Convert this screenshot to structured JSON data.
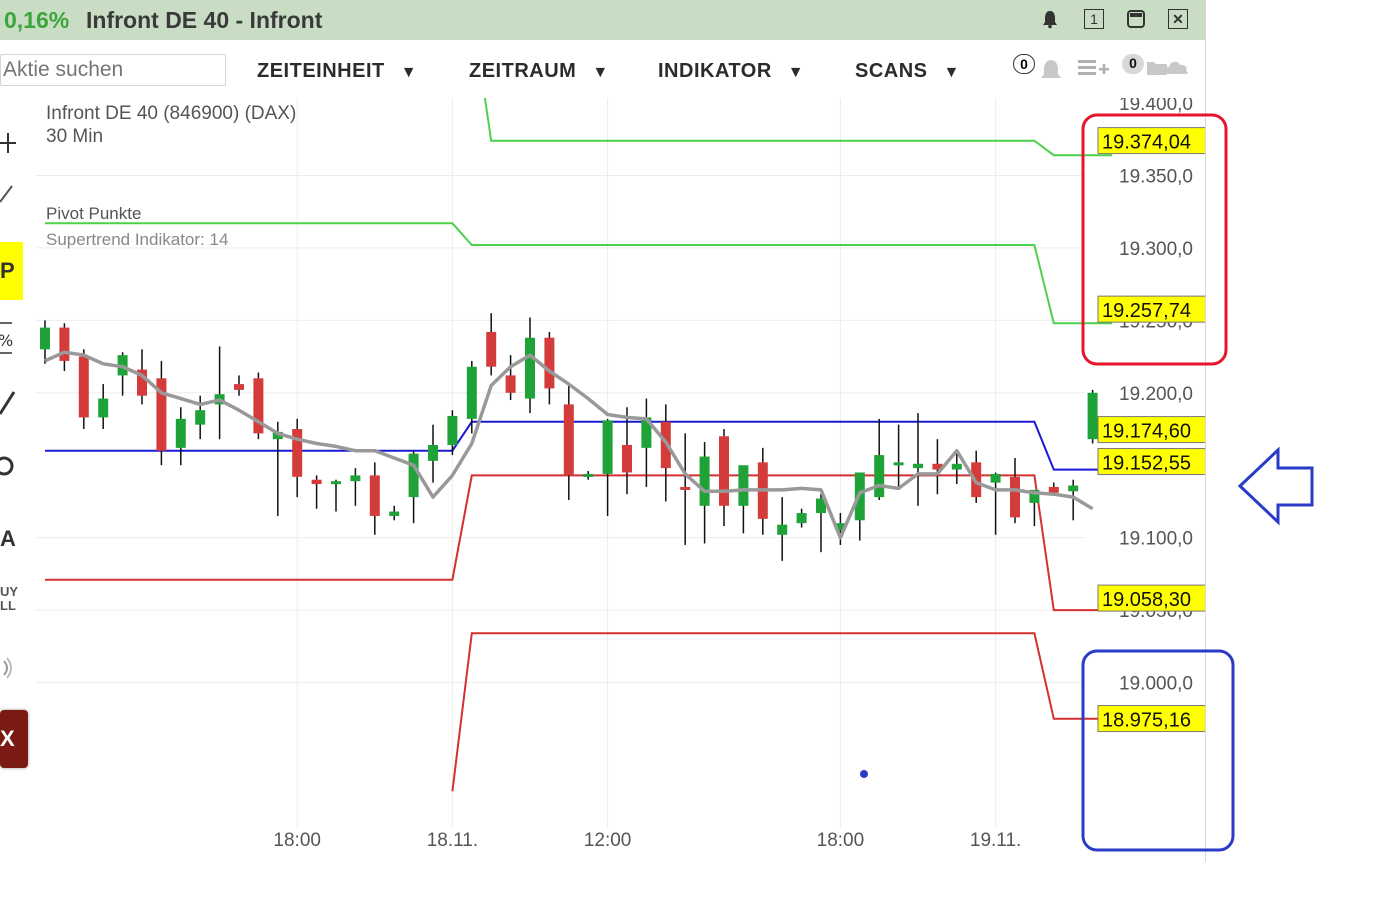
{
  "window": {
    "change_pct": "0,16%",
    "title": "Infront DE 40 - Infront"
  },
  "toolbar": {
    "search_placeholder": "Aktie suchen",
    "menus": [
      {
        "label": "ZEITEINHEIT"
      },
      {
        "label": "ZEITRAUM"
      },
      {
        "label": "INDIKATOR"
      },
      {
        "label": "SCANS"
      }
    ],
    "alerts_count": "0",
    "notes_count": "0"
  },
  "side_tools": [
    "crosshair-icon",
    "line-tool-icon",
    "pivot-icon",
    "percent-icon",
    "pen-icon",
    "circle-icon",
    "text-tool-icon",
    "buy-sell-icon",
    "sound-icon",
    "close-panel-icon"
  ],
  "side_labels": {
    "pivot": "P",
    "text": "A",
    "buysell": "UY\nLL",
    "close": "X"
  },
  "colors": {
    "titlebar": "#c8ddc4",
    "up_candle": "#1fa339",
    "down_candle": "#d43c3c",
    "supertrend": "#999999",
    "pivot_center": "#1a1ad6",
    "resistance": "#4cd14c",
    "support": "#d43030",
    "price_tag": "#ffff00",
    "red_box": "#e8142a",
    "blue_box": "#2a3bc8",
    "arrow": "#2a3bc8"
  },
  "chart_data": {
    "type": "candlestick",
    "title": "Infront DE 40 (846900) (DAX)",
    "subtitle": "30 Min",
    "legend": [
      "Pivot Punkte",
      "Supertrend Indikator: 14"
    ],
    "ylim": [
      18930,
      19400
    ],
    "yticks": [
      {
        "value": 19400,
        "label": "19.400,0"
      },
      {
        "value": 19350,
        "label": "19.350,0"
      },
      {
        "value": 19300,
        "label": "19.300,0"
      },
      {
        "value": 19250,
        "label": "19.250,0"
      },
      {
        "value": 19200,
        "label": "19.200,0"
      },
      {
        "value": 19100,
        "label": "19.100,0"
      },
      {
        "value": 19050,
        "label": "19.050,0"
      },
      {
        "value": 19000,
        "label": "19.000,0"
      }
    ],
    "xticks": [
      {
        "index": 13,
        "label": "18:00"
      },
      {
        "index": 21,
        "label": "18.11."
      },
      {
        "index": 29,
        "label": "12:00"
      },
      {
        "index": 41,
        "label": "18:00"
      },
      {
        "index": 49,
        "label": "19.11."
      }
    ],
    "candles": [
      {
        "o": 19230,
        "h": 19250,
        "l": 19220,
        "c": 19245
      },
      {
        "o": 19245,
        "h": 19248,
        "l": 19215,
        "c": 19222
      },
      {
        "o": 19225,
        "h": 19230,
        "l": 19175,
        "c": 19183
      },
      {
        "o": 19183,
        "h": 19206,
        "l": 19175,
        "c": 19196
      },
      {
        "o": 19212,
        "h": 19228,
        "l": 19198,
        "c": 19226
      },
      {
        "o": 19216,
        "h": 19230,
        "l": 19192,
        "c": 19198
      },
      {
        "o": 19210,
        "h": 19222,
        "l": 19150,
        "c": 19160
      },
      {
        "o": 19162,
        "h": 19190,
        "l": 19150,
        "c": 19182
      },
      {
        "o": 19178,
        "h": 19198,
        "l": 19168,
        "c": 19188
      },
      {
        "o": 19192,
        "h": 19232,
        "l": 19168,
        "c": 19199
      },
      {
        "o": 19206,
        "h": 19212,
        "l": 19198,
        "c": 19202
      },
      {
        "o": 19210,
        "h": 19214,
        "l": 19168,
        "c": 19172
      },
      {
        "o": 19168,
        "h": 19180,
        "l": 19115,
        "c": 19173
      },
      {
        "o": 19175,
        "h": 19182,
        "l": 19128,
        "c": 19142
      },
      {
        "o": 19140,
        "h": 19143,
        "l": 19120,
        "c": 19137
      },
      {
        "o": 19137,
        "h": 19140,
        "l": 19118,
        "c": 19139
      },
      {
        "o": 19139,
        "h": 19148,
        "l": 19122,
        "c": 19143
      },
      {
        "o": 19143,
        "h": 19152,
        "l": 19102,
        "c": 19115
      },
      {
        "o": 19115,
        "h": 19122,
        "l": 19112,
        "c": 19118
      },
      {
        "o": 19128,
        "h": 19160,
        "l": 19110,
        "c": 19158
      },
      {
        "o": 19153,
        "h": 19178,
        "l": 19138,
        "c": 19164
      },
      {
        "o": 19164,
        "h": 19188,
        "l": 19157,
        "c": 19184
      },
      {
        "o": 19182,
        "h": 19222,
        "l": 19172,
        "c": 19218
      },
      {
        "o": 19242,
        "h": 19255,
        "l": 19212,
        "c": 19218
      },
      {
        "o": 19212,
        "h": 19226,
        "l": 19195,
        "c": 19200
      },
      {
        "o": 19196,
        "h": 19252,
        "l": 19186,
        "c": 19238
      },
      {
        "o": 19238,
        "h": 19242,
        "l": 19192,
        "c": 19203
      },
      {
        "o": 19192,
        "h": 19205,
        "l": 19126,
        "c": 19143
      },
      {
        "o": 19143,
        "h": 19146,
        "l": 19140,
        "c": 19144
      },
      {
        "o": 19144,
        "h": 19182,
        "l": 19115,
        "c": 19181
      },
      {
        "o": 19164,
        "h": 19190,
        "l": 19130,
        "c": 19145
      },
      {
        "o": 19162,
        "h": 19196,
        "l": 19135,
        "c": 19183
      },
      {
        "o": 19180,
        "h": 19192,
        "l": 19125,
        "c": 19148
      },
      {
        "o": 19135,
        "h": 19172,
        "l": 19095,
        "c": 19133
      },
      {
        "o": 19122,
        "h": 19166,
        "l": 19096,
        "c": 19156
      },
      {
        "o": 19170,
        "h": 19175,
        "l": 19108,
        "c": 19122
      },
      {
        "o": 19122,
        "h": 19130,
        "l": 19103,
        "c": 19150
      },
      {
        "o": 19152,
        "h": 19162,
        "l": 19102,
        "c": 19113
      },
      {
        "o": 19102,
        "h": 19128,
        "l": 19084,
        "c": 19109
      },
      {
        "o": 19110,
        "h": 19120,
        "l": 19107,
        "c": 19117
      },
      {
        "o": 19117,
        "h": 19130,
        "l": 19090,
        "c": 19127
      },
      {
        "o": 19105,
        "h": 19117,
        "l": 19095,
        "c": 19110
      },
      {
        "o": 19112,
        "h": 19125,
        "l": 19098,
        "c": 19145
      },
      {
        "o": 19128,
        "h": 19182,
        "l": 19126,
        "c": 19157
      },
      {
        "o": 19152,
        "h": 19178,
        "l": 19134,
        "c": 19152
      },
      {
        "o": 19148,
        "h": 19186,
        "l": 19122,
        "c": 19151
      },
      {
        "o": 19151,
        "h": 19168,
        "l": 19130,
        "c": 19147
      },
      {
        "o": 19147,
        "h": 19158,
        "l": 19137,
        "c": 19151
      },
      {
        "o": 19152,
        "h": 19160,
        "l": 19124,
        "c": 19128
      },
      {
        "o": 19138,
        "h": 19145,
        "l": 19102,
        "c": 19144
      },
      {
        "o": 19142,
        "h": 19155,
        "l": 19110,
        "c": 19114
      },
      {
        "o": 19124,
        "h": 19132,
        "l": 19108,
        "c": 19133
      },
      {
        "o": 19135,
        "h": 19138,
        "l": 19130,
        "c": 19131
      },
      {
        "o": 19132,
        "h": 19140,
        "l": 19112,
        "c": 19136
      },
      {
        "o": 19168,
        "h": 19202,
        "l": 19165,
        "c": 19200
      }
    ],
    "supertrend": [
      19222,
      19228,
      19226,
      19220,
      19218,
      19212,
      19200,
      19196,
      19192,
      19195,
      19188,
      19180,
      19172,
      19168,
      19165,
      19163,
      19160,
      19160,
      19155,
      19150,
      19128,
      19143,
      19165,
      19205,
      19218,
      19226,
      19215,
      19206,
      19196,
      19185,
      19183,
      19182,
      19166,
      19144,
      19132,
      19132,
      19133,
      19133,
      19133,
      19134,
      19133,
      19100,
      19131,
      19136,
      19134,
      19144,
      19144,
      19160,
      19138,
      19133,
      19133,
      19131,
      19130,
      19128,
      19120
    ],
    "lines": [
      {
        "name": "R2",
        "points": [
          [
            0,
            19465
          ],
          [
            22,
            19465
          ],
          [
            23,
            19374
          ],
          [
            51,
            19374
          ],
          [
            52,
            19364
          ],
          [
            55,
            19364
          ]
        ]
      },
      {
        "name": "R1",
        "points": [
          [
            0,
            19317
          ],
          [
            21,
            19317
          ],
          [
            22,
            19302
          ],
          [
            51,
            19302
          ],
          [
            52,
            19248
          ],
          [
            55,
            19248
          ]
        ]
      },
      {
        "name": "P",
        "points": [
          [
            0,
            19160
          ],
          [
            21,
            19160
          ],
          [
            22,
            19180
          ],
          [
            51,
            19180
          ],
          [
            52,
            19147
          ],
          [
            55,
            19147
          ]
        ]
      },
      {
        "name": "S1",
        "points": [
          [
            0,
            19071
          ],
          [
            21,
            19071
          ],
          [
            22,
            19143
          ],
          [
            51,
            19143
          ],
          [
            52,
            19050
          ],
          [
            55,
            19050
          ]
        ]
      },
      {
        "name": "S2",
        "points": [
          [
            21,
            18925
          ],
          [
            22,
            19034
          ],
          [
            51,
            19034
          ],
          [
            52,
            18975
          ],
          [
            55,
            18975
          ]
        ]
      }
    ],
    "price_tags": [
      {
        "value": 19374.04,
        "label": "19.374,04"
      },
      {
        "value": 19257.74,
        "label": "19.257,74"
      },
      {
        "value": 19174.6,
        "label": "19.174,60"
      },
      {
        "value": 19152.55,
        "label": "19.152,55"
      },
      {
        "value": 19058.3,
        "label": "19.058,30"
      },
      {
        "value": 18975.16,
        "label": "18.975,16"
      }
    ],
    "grid": true
  }
}
